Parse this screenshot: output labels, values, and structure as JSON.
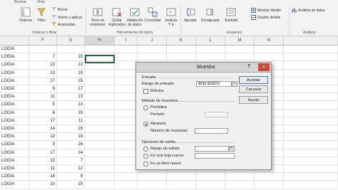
{
  "ribbon": {
    "tabs": [
      "Revisar",
      "Vista"
    ],
    "groups": {
      "ordenar_filtrar": {
        "label": "Ordenar y filtrar",
        "ordenar": "Ordenar",
        "filtro": "Filtro",
        "borrar": "Borrar",
        "volver_aplicar": "Volver a aplicar",
        "avanzadas": "Avanzadas"
      },
      "herramientas": {
        "label": "Herramientas de datos",
        "texto_columnas": "Texto en columnas",
        "quitar_duplicados": "Quitar duplicados",
        "validacion": "Validación de datos",
        "consolidar": "Consolidar",
        "analisis": "Análisis Y si"
      },
      "esquema": {
        "label": "Esquema",
        "agrupar": "Agrupar",
        "desagrupar": "Desagrupar",
        "subtotal": "Subtotal",
        "mostrar_detalle": "Mostrar detalle",
        "ocultar_detalle": "Ocultar detalle"
      },
      "analisis": {
        "label": "Análisis",
        "analisis_datos": "Análisis de datos"
      }
    }
  },
  "columns": [
    "F",
    "G",
    "H",
    "I",
    "J",
    "K",
    "L",
    "M",
    "N"
  ],
  "selected_column": "H",
  "rows": [
    {
      "e": "LOGIA",
      "f": "",
      "g": ""
    },
    {
      "e": "LOGIA",
      "f": "7",
      "g": "19"
    },
    {
      "e": "LOGIA",
      "f": "13",
      "g": "13"
    },
    {
      "e": "LOGIA",
      "f": "13",
      "g": "19"
    },
    {
      "e": "LOGIA",
      "f": "17",
      "g": "15"
    },
    {
      "e": "LOGIA",
      "f": "6",
      "g": "17"
    },
    {
      "e": "LOGIA",
      "f": "11",
      "g": "13"
    },
    {
      "e": "LOGIA",
      "f": "5",
      "g": "13"
    },
    {
      "e": "LOGIA",
      "f": "6",
      "g": "19"
    },
    {
      "e": "LOGIA",
      "f": "17",
      "g": "11"
    },
    {
      "e": "LOGIA",
      "f": "14",
      "g": "18"
    },
    {
      "e": "LOGIA",
      "f": "12",
      "g": "19"
    },
    {
      "e": "LOGIA",
      "f": "9",
      "g": "16"
    },
    {
      "e": "LOGIA",
      "f": "17",
      "g": "14"
    },
    {
      "e": "LOGIA",
      "f": "10",
      "g": "7"
    },
    {
      "e": "LOGIA",
      "f": "11",
      "g": "12"
    },
    {
      "e": "LOGIA",
      "f": "14",
      "g": "9"
    },
    {
      "e": "LOGIA",
      "f": "10",
      "g": "15"
    }
  ],
  "dialog": {
    "title": "Muestra",
    "help": "?",
    "close": "×",
    "entrada_label": "Entrada",
    "rango_entrada_label": "Rango de entrada:",
    "rango_entrada_value": "$F$2:$G$201",
    "rotulos_label": "Rótulos",
    "metodo_label": "Método de muestreo",
    "periodico_label": "Periódico",
    "periodo_label": "Período:",
    "aleatorio_label": "Aleatorio",
    "numero_muestras_label": "Número de muestras:",
    "numero_muestras_value": "",
    "opciones_salida_label": "Opciones de salida",
    "rango_salida_label": "Rango de salida:",
    "hoja_nueva_label": "En una hoja nueva:",
    "libro_nuevo_label": "En un libro nuevo",
    "aceptar": "Aceptar",
    "cancelar": "Cancelar",
    "ayuda": "Ayuda",
    "ref_icon": "collapse-dialog-icon"
  }
}
